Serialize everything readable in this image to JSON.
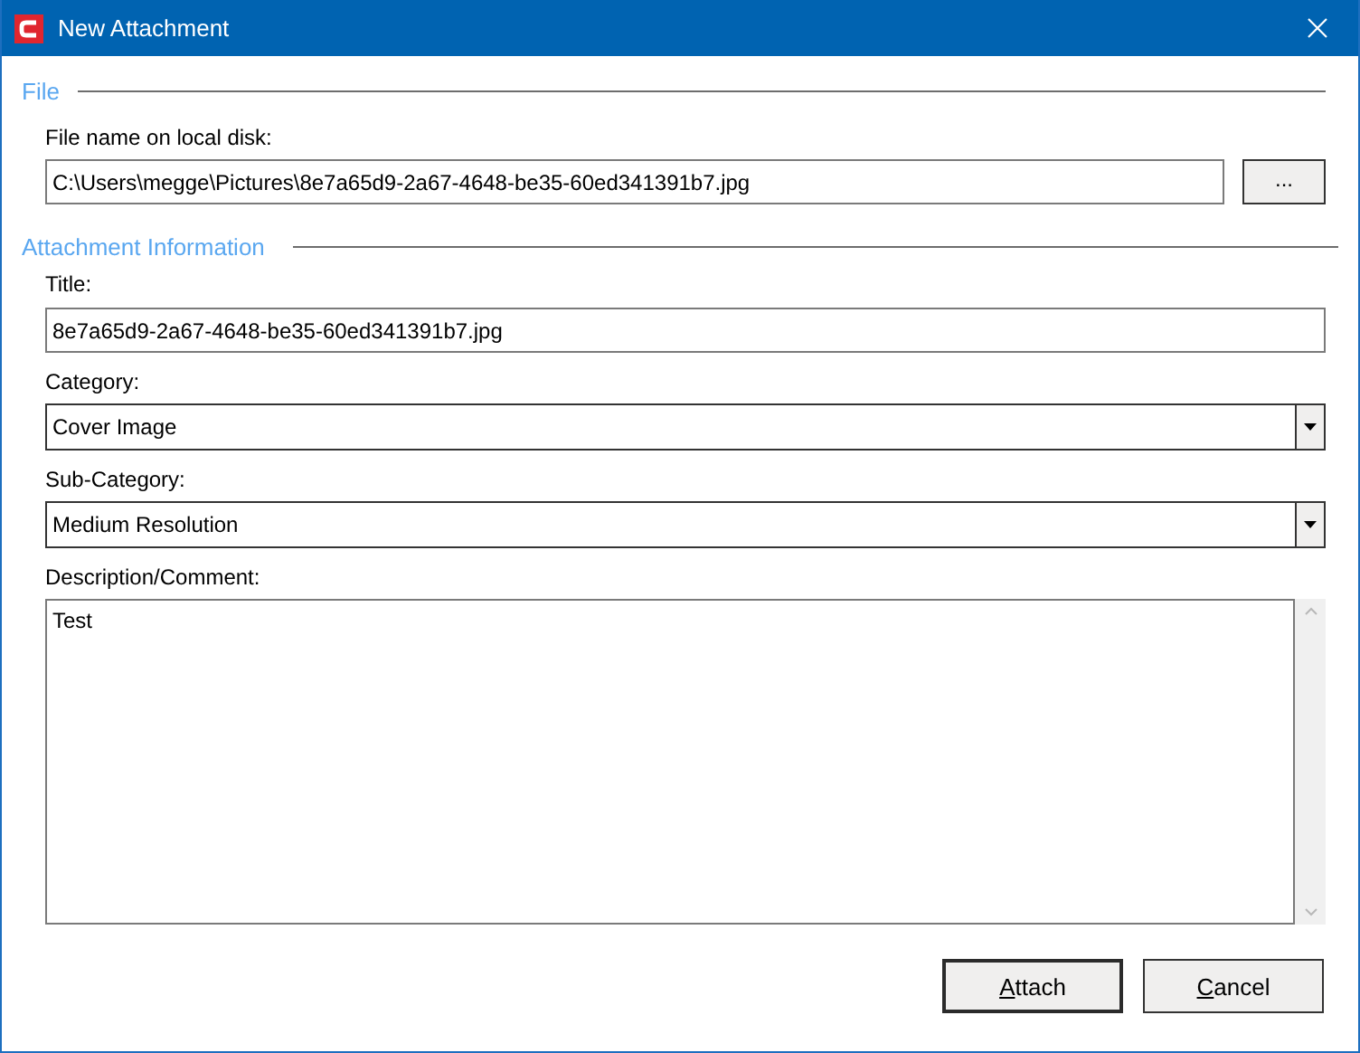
{
  "window": {
    "title": "New Attachment"
  },
  "file_group": {
    "legend": "File",
    "label": "File name on local disk:",
    "path": "C:\\Users\\megge\\Pictures\\8e7a65d9-2a67-4648-be35-60ed341391b7.jpg",
    "browse_button": "..."
  },
  "info_group": {
    "legend": "Attachment Information",
    "fields": [
      {
        "kind": "text",
        "label": "Title:",
        "value": "8e7a65d9-2a67-4648-be35-60ed341391b7.jpg"
      },
      {
        "kind": "combo",
        "label": "Category:",
        "value": "Cover Image"
      },
      {
        "kind": "combo",
        "label": "Sub-Category:",
        "value": "Medium Resolution"
      },
      {
        "kind": "memo",
        "label": "Description/Comment:",
        "value": "Test"
      }
    ]
  },
  "buttons": [
    {
      "label": "Attach",
      "default": true
    },
    {
      "label": "Cancel",
      "default": false
    }
  ]
}
